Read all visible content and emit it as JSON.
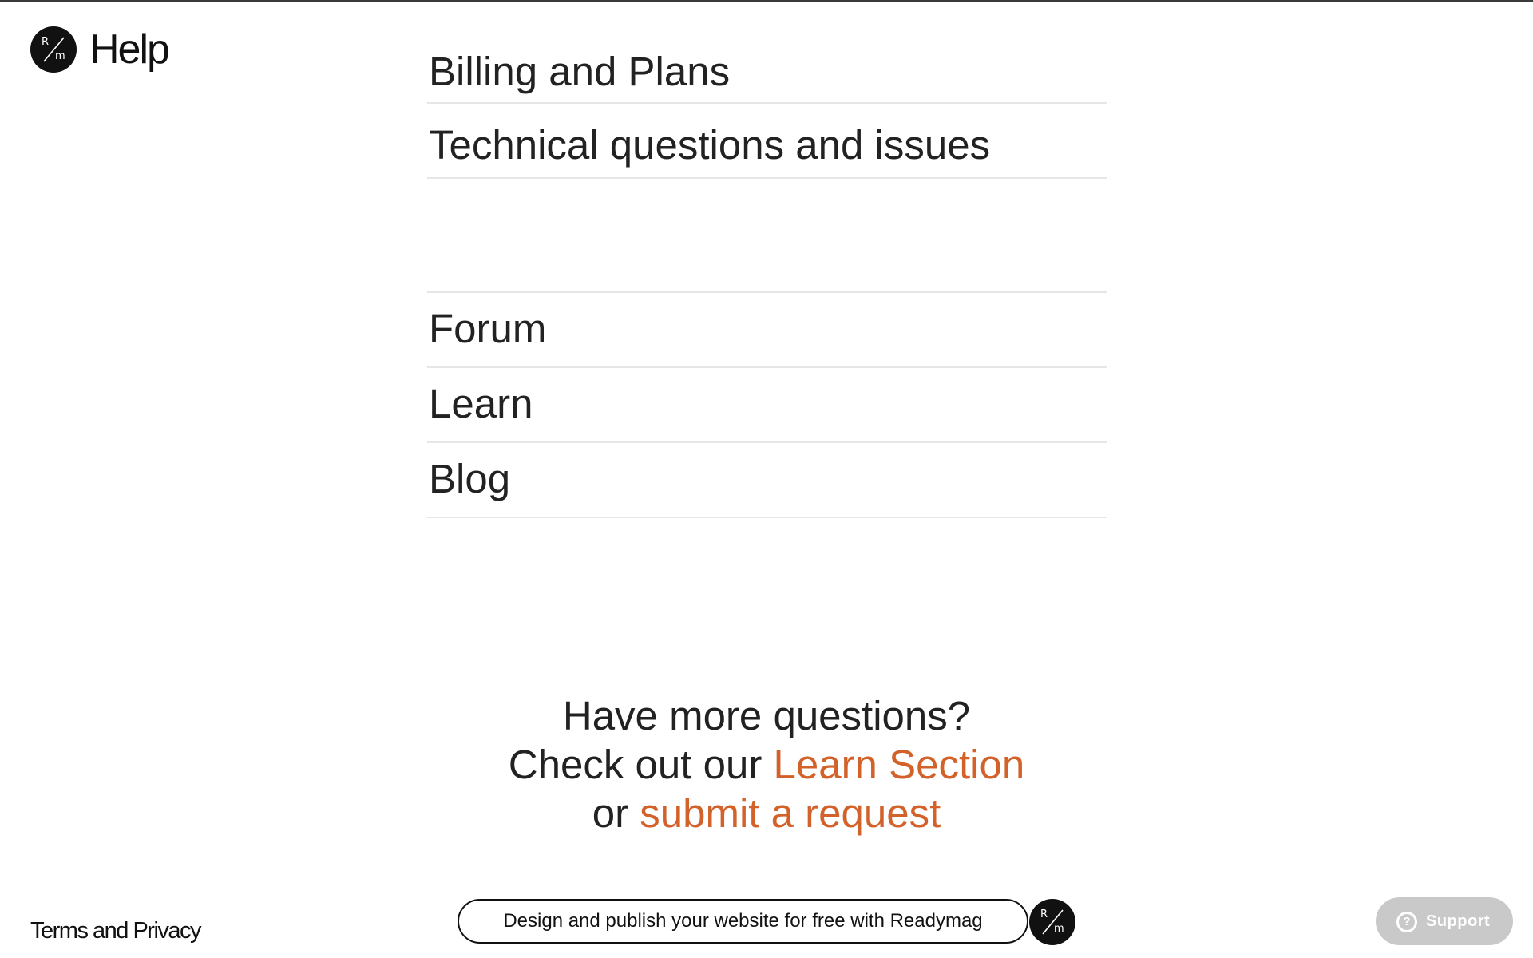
{
  "header": {
    "logo_r": "R",
    "logo_m": "m",
    "title": "Help"
  },
  "categories": [
    {
      "label": "Billing and Plans"
    },
    {
      "label": "Technical questions and issues"
    }
  ],
  "resources": [
    {
      "label": "Forum"
    },
    {
      "label": "Learn"
    },
    {
      "label": "Blog"
    }
  ],
  "cta": {
    "line1": "Have more questions?",
    "line2_prefix": "Check out our ",
    "learn_link": "Learn Section",
    "line3_prefix": "or ",
    "request_link": "submit a request"
  },
  "footer": {
    "terms": "Terms and Privacy",
    "promo": "Design and publish your website for free with Readymag",
    "promo_logo_r": "R",
    "promo_logo_m": "m",
    "support_icon": "?",
    "support_label": "Support"
  },
  "colors": {
    "accent": "#d2622a",
    "text": "#222222",
    "divider": "#e6e6e6",
    "support_bg": "#c9c9c9"
  },
  "icons": {
    "site_logo": "readymag-logo-icon",
    "support": "question-circle-icon"
  }
}
